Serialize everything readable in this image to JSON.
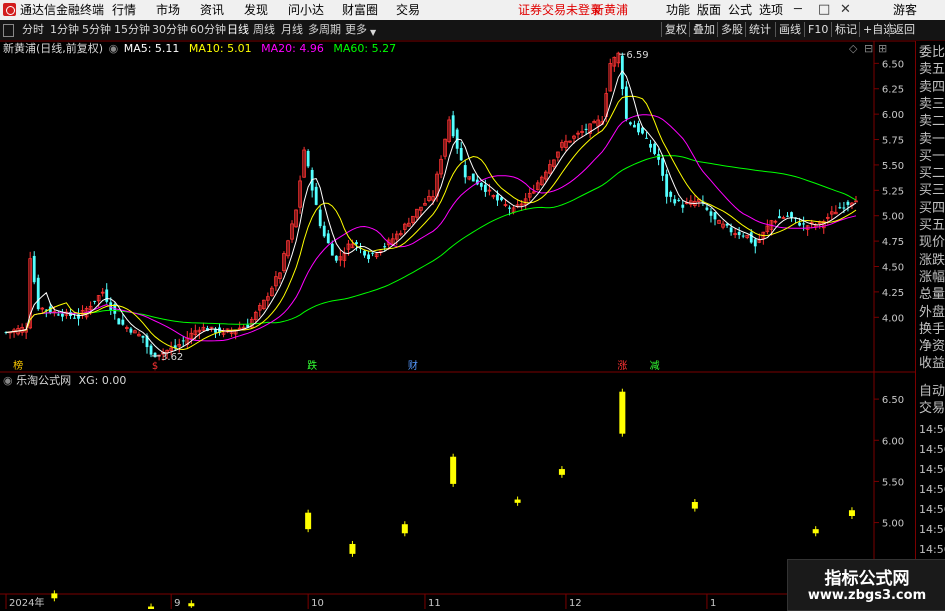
{
  "menubar": {
    "app_title": "通达信金融终端",
    "items": [
      "行情",
      "市场",
      "资讯",
      "发现",
      "问小达",
      "财富圈",
      "交易"
    ],
    "notice": "证券交易未登录",
    "stock_name": "新黄浦",
    "right_items": [
      "功能",
      "版面",
      "公式",
      "选项"
    ],
    "user": "游客"
  },
  "periodbar": {
    "periods": [
      "分时",
      "1分钟",
      "5分钟",
      "15分钟",
      "30分钟",
      "60分钟",
      "日线",
      "周线",
      "月线",
      "多周期",
      "更多"
    ],
    "active": "日线",
    "tools": [
      "复权",
      "叠加",
      "多股",
      "统计",
      "画线",
      "F10",
      "标记",
      "+自选",
      "返回"
    ]
  },
  "main_legend": {
    "title": "新黄浦(日线,前复权)",
    "ma5": "MA5: 5.11",
    "ma10": "MA10: 5.01",
    "ma20": "MA20: 4.96",
    "ma60": "MA60: 5.27"
  },
  "sub_legend": {
    "title": "乐淘公式网",
    "xg": "XG: 0.00"
  },
  "annotations": {
    "high_label": "6.59",
    "low_label": "3.62",
    "markers": [
      "榜",
      "$",
      "跌",
      "财",
      "涨",
      "减"
    ]
  },
  "right_panel": {
    "items": [
      "委比",
      "卖五",
      "卖四",
      "卖三",
      "卖二",
      "卖一",
      "买一",
      "买二",
      "买三",
      "买四",
      "买五",
      "现价",
      "涨跌",
      "涨幅",
      "总量",
      "外盘",
      "换手",
      "净资",
      "收益"
    ],
    "lower_items": [
      "自动",
      "交易"
    ],
    "time_items": [
      "14:56",
      "14:56",
      "14:56",
      "14:56",
      "14:56",
      "14:56",
      "14:56",
      "14:56",
      "14:56"
    ]
  },
  "watermark": {
    "line1": "指标公式网",
    "line2": "www.zbgs3.com"
  },
  "colors": {
    "up": "#ff3333",
    "down": "#54ffff",
    "ma5": "#ffffff",
    "ma10": "#ffff00",
    "ma20": "#ff00ff",
    "ma60": "#00ff00",
    "signal": "#ffff00",
    "grid": "#7a0000"
  },
  "chart_data": [
    {
      "type": "candlestick",
      "title": "新黄浦(日线,前复权)",
      "y_ticks": [
        "6.50",
        "6.25",
        "6.00",
        "5.75",
        "5.50",
        "5.25",
        "5.00",
        "4.75",
        "4.50",
        "4.25",
        "4.00"
      ],
      "ylim": [
        3.55,
        6.72
      ],
      "x_ticks": [
        "2024年",
        "9",
        "10",
        "11",
        "12",
        "1"
      ],
      "x_tick_index": [
        0,
        41,
        75,
        104,
        139,
        174
      ],
      "n_bars": 212,
      "series_points": [
        [
          0,
          3.85
        ],
        [
          5,
          3.9
        ],
        [
          6,
          4.6
        ],
        [
          8,
          4.1
        ],
        [
          12,
          4.05
        ],
        [
          18,
          4.0
        ],
        [
          24,
          4.25
        ],
        [
          28,
          3.95
        ],
        [
          34,
          3.8
        ],
        [
          36,
          3.62
        ],
        [
          42,
          3.7
        ],
        [
          48,
          3.9
        ],
        [
          54,
          3.85
        ],
        [
          60,
          3.92
        ],
        [
          64,
          4.15
        ],
        [
          68,
          4.45
        ],
        [
          72,
          5.05
        ],
        [
          74,
          5.65
        ],
        [
          78,
          4.9
        ],
        [
          82,
          4.55
        ],
        [
          86,
          4.75
        ],
        [
          90,
          4.6
        ],
        [
          94,
          4.7
        ],
        [
          98,
          4.85
        ],
        [
          102,
          5.05
        ],
        [
          106,
          5.2
        ],
        [
          110,
          5.95
        ],
        [
          114,
          5.4
        ],
        [
          118,
          5.3
        ],
        [
          122,
          5.15
        ],
        [
          126,
          5.05
        ],
        [
          130,
          5.2
        ],
        [
          134,
          5.45
        ],
        [
          138,
          5.7
        ],
        [
          142,
          5.8
        ],
        [
          148,
          5.95
        ],
        [
          150,
          6.5
        ],
        [
          152,
          6.59
        ],
        [
          154,
          5.95
        ],
        [
          158,
          5.8
        ],
        [
          162,
          5.55
        ],
        [
          164,
          5.2
        ],
        [
          168,
          5.1
        ],
        [
          172,
          5.15
        ],
        [
          176,
          4.95
        ],
        [
          180,
          4.85
        ],
        [
          184,
          4.8
        ],
        [
          186,
          4.7
        ],
        [
          190,
          4.95
        ],
        [
          194,
          5.0
        ],
        [
          198,
          4.9
        ],
        [
          202,
          4.92
        ],
        [
          206,
          5.05
        ],
        [
          210,
          5.15
        ],
        [
          212,
          5.2
        ]
      ],
      "ma": {
        "MA5": {
          "last": 5.11
        },
        "MA10": {
          "last": 5.01
        },
        "MA20": {
          "last": 4.96
        },
        "MA60": {
          "last": 5.27
        }
      }
    },
    {
      "type": "bar",
      "title": "乐淘公式网",
      "y_ticks": [
        "6.50",
        "6.00",
        "5.50",
        "5.00",
        "4.50"
      ],
      "ylim": [
        3.95,
        6.72
      ],
      "signals": [
        [
          12,
          4.08,
          4.14
        ],
        [
          36,
          3.93,
          3.98
        ],
        [
          46,
          4.0,
          4.02
        ],
        [
          75,
          4.92,
          5.12
        ],
        [
          86,
          4.62,
          4.74
        ],
        [
          99,
          4.87,
          4.98
        ],
        [
          111,
          5.47,
          5.8
        ],
        [
          127,
          5.24,
          5.28
        ],
        [
          138,
          5.58,
          5.65
        ],
        [
          153,
          6.08,
          6.59
        ],
        [
          171,
          5.17,
          5.25
        ],
        [
          201,
          4.87,
          4.92
        ],
        [
          210,
          5.08,
          5.15
        ]
      ]
    }
  ]
}
